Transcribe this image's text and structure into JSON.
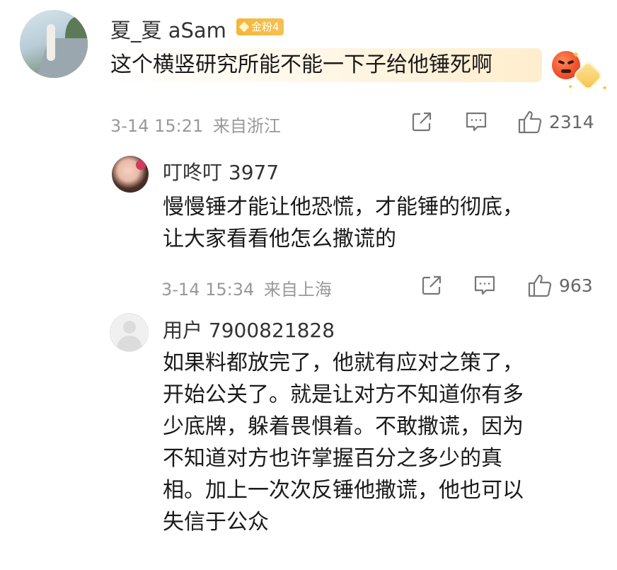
{
  "comment": {
    "username": "夏_夏 aSam",
    "badge": "金粉4",
    "text": "这个横竖研究所能不能一下子给他锤死啊",
    "emoji": "angry-face",
    "time": "3-14 15:21",
    "location": "来自浙江",
    "likes": "2314"
  },
  "replies": [
    {
      "username": "叮咚叮 3977",
      "lines": [
        "慢慢锤才能让他恐慌，才能锤的彻底，",
        "让大家看看他怎么撒谎的"
      ],
      "time": "3-14 15:34",
      "location": "来自上海",
      "likes": "963"
    },
    {
      "username": "用户 7900821828",
      "lines": [
        "如果料都放完了，他就有应对之策了，",
        "开始公关了。就是让对方不知道你有多",
        "少底牌，躲着畏惧着。不敢撒谎，因为",
        "不知道对方也许掌握百分之多少的真",
        "相。加上一次次反锤他撒谎，他也可以",
        "失信于公众"
      ]
    }
  ],
  "icons": {
    "share": "share-icon",
    "comment": "comment-icon",
    "like": "thumbs-up-icon"
  },
  "colors": {
    "badge": "#f3b63a",
    "meta": "#999999"
  }
}
